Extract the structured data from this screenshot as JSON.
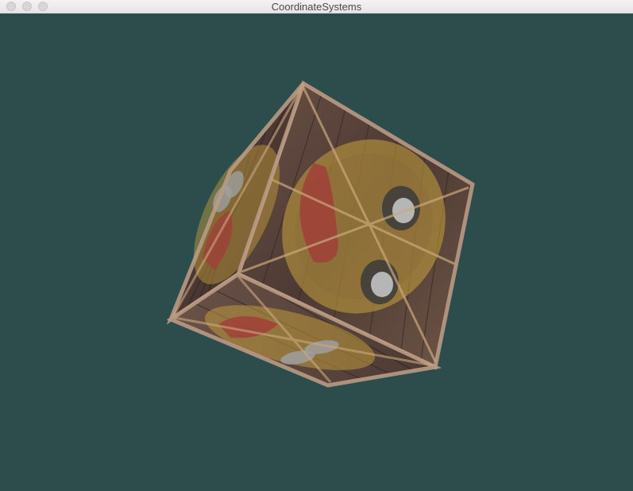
{
  "window": {
    "title": "CoordinateSystems"
  },
  "titlebar": {
    "buttons": [
      {
        "name": "close",
        "color": "#d7d7d7"
      },
      {
        "name": "minimize",
        "color": "#d7d7d7"
      },
      {
        "name": "maximize",
        "color": "#d7d7d7"
      }
    ]
  },
  "scene": {
    "clear_color": "#2e4c4c",
    "object": "textured-cube",
    "textures": [
      "wooden-crate",
      "awesome-face"
    ]
  }
}
